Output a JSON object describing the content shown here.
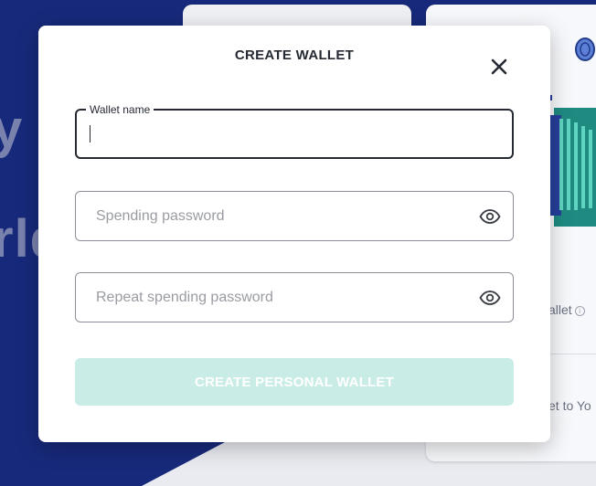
{
  "background": {
    "hero_line_1": "y",
    "hero_line_2": "rld",
    "card_label_1": "allet",
    "card_label_1_info": "i",
    "card_label_2": "et to Yo"
  },
  "modal": {
    "title": "CREATE WALLET",
    "close_icon": "close-icon",
    "wallet_name": {
      "legend": "Wallet name",
      "value": ""
    },
    "spending_password": {
      "placeholder": "Spending password",
      "icon": "eye-icon"
    },
    "repeat_password": {
      "placeholder": "Repeat spending password",
      "icon": "eye-icon"
    },
    "submit_label": "CREATE PERSONAL WALLET",
    "submit_color": "#c9ede6"
  }
}
